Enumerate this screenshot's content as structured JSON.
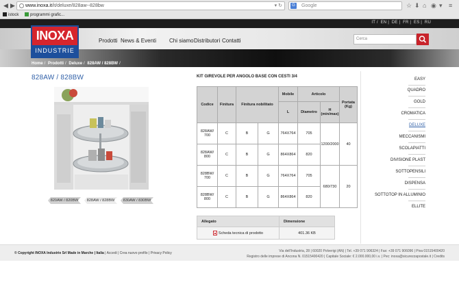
{
  "browser": {
    "url_domain": "www.inoxa.it",
    "url_path": "/it/deluxe/828aw--828bw",
    "search_engine": "G",
    "search_placeholder": "Google",
    "bookmarks": [
      {
        "label": "istock",
        "color": "#222222"
      },
      {
        "label": "programmi grafic...",
        "color": "#3a9b3a"
      }
    ]
  },
  "site": {
    "languages": [
      "IT",
      "EN",
      "DE",
      "FR",
      "ES",
      "RU"
    ],
    "logo_top": "INOXA",
    "logo_bottom": "INDUSTRIE",
    "nav": [
      "Prodotti",
      "News & Eventi",
      "Chi siamo",
      "Distributori",
      "Contatti"
    ],
    "search_placeholder": "Cerca",
    "breadcrumb": [
      "Home",
      "Prodotti",
      "Deluxe",
      "828AW / 828BW"
    ],
    "brand_red": "#c8242b",
    "brand_blue": "#2f5fa7"
  },
  "product": {
    "title": "828AW / 828BW",
    "thumbs": [
      "820AW / 820BW",
      "828AW / 828BW",
      "830AW / 830BW"
    ],
    "selected_thumb": 1
  },
  "table": {
    "title": "KIT GIREVOLE PER ANGOLO BASE CON CESTI 3/4",
    "headers": {
      "codice": "Codice",
      "finitura": "Finitura",
      "finitura_nob": "Finitura nobilitato",
      "mobile": "Mobile",
      "articolo": "Articolo",
      "portata": "Portata (Kg)",
      "l": "L",
      "diametro": "Diametro",
      "h": "H (min/max)"
    },
    "rows": [
      {
        "codice": "828AW/ 700",
        "finitura": "C",
        "nob_b": "B",
        "nob_g": "G",
        "l": "764X764",
        "diametro": "705"
      },
      {
        "codice": "828AW/ 800",
        "finitura": "C",
        "nob_b": "B",
        "nob_g": "G",
        "l": "864X864",
        "diametro": "820"
      },
      {
        "codice": "828BW/ 700",
        "finitura": "C",
        "nob_b": "B",
        "nob_g": "G",
        "l": "764X764",
        "diametro": "705"
      },
      {
        "codice": "828BW/ 800",
        "finitura": "C",
        "nob_b": "B",
        "nob_g": "G",
        "l": "864X864",
        "diametro": "820"
      }
    ],
    "h_aw": "1200/2000",
    "portata_aw": "40",
    "h_bw": "680/730",
    "portata_bw": "20"
  },
  "attachments": {
    "col_allegato": "Allegato",
    "col_dimensione": "Dimensione",
    "rows": [
      {
        "name": "Scheda tecnica di prodotto",
        "size": "401.36 KB"
      }
    ]
  },
  "sidebar": {
    "items": [
      "EASY",
      "QUADRO",
      "GOLD",
      "CROMATICA",
      "DELUXE",
      "MECCANISMI",
      "SCOLAPIATTI",
      "DIVISIONE PLAST",
      "SOTTOPENSILI",
      "DISPENSA",
      "SOTTOTOP IN ALLUMINIO",
      "ELLITE"
    ],
    "active_index": 4
  },
  "footer": {
    "copyright": "© Copyright INOXA Industrie Srl Made in Marche | Italia",
    "links": "Accedi | Crea nuovo profilo | Privacy Policy",
    "address": "Via dell'Industria, 28 | 60020 Polverigi (AN) | Tel. +39 071 906324 | Fax: +39 071 906096 | Piva 01515400420",
    "registry": "Registro delle imprese di Ancona N. 01515400420 | Capitale Sociale: € 2.000.000,00 i.v. | Pec: inoxa@sicurezzapostale.it | Credits"
  }
}
